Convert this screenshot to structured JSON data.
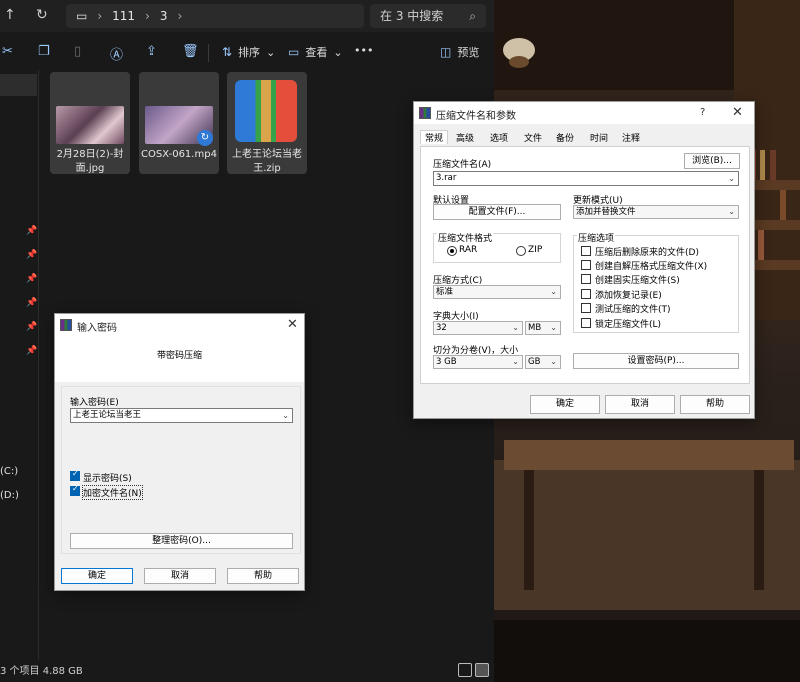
{
  "explorer": {
    "address": {
      "segments": [
        "111",
        "3"
      ],
      "search_placeholder": "在 3 中搜索"
    },
    "toolbar": {
      "sort_label": "排序",
      "view_label": "查看",
      "preview_label": "预览"
    },
    "files": [
      {
        "name": "2月28日(2)-封面.jpg",
        "icon": "image-thumbnail"
      },
      {
        "name": "COSX-061.mp4",
        "icon": "video-thumbnail"
      },
      {
        "name": "上老王论坛当老王.zip",
        "icon": "winrar-archive-icon"
      }
    ],
    "drives": [
      "(C:)",
      "(D:)"
    ],
    "status": "3 个项目   4.88 GB"
  },
  "archive_dialog": {
    "title": "压缩文件名和参数",
    "help_glyph": "?",
    "tabs": [
      "常规",
      "高级",
      "选项",
      "文件",
      "备份",
      "时间",
      "注释"
    ],
    "archive_name_label": "压缩文件名(A)",
    "browse_label": "浏览(B)...",
    "archive_name": "3.rar",
    "default_settings_label": "默认设置",
    "profiles_label": "配置文件(F)...",
    "update_mode_label": "更新模式(U)",
    "update_mode": "添加并替换文件",
    "format_label": "压缩文件格式",
    "format_rar": "RAR",
    "format_zip": "ZIP",
    "method_label": "压缩方式(C)",
    "method": "标准",
    "dict_label": "字典大小(I)",
    "dict_size": "32",
    "dict_unit": "MB",
    "split_label": "切分为分卷(V)，大小",
    "split_size": "3 GB",
    "split_unit": "GB",
    "options_label": "压缩选项",
    "options": [
      "压缩后删除原来的文件(D)",
      "创建自解压格式压缩文件(X)",
      "创建固实压缩文件(S)",
      "添加恢复记录(E)",
      "测试压缩的文件(T)",
      "锁定压缩文件(L)"
    ],
    "set_password_label": "设置密码(P)...",
    "ok_label": "确定",
    "cancel_label": "取消",
    "help_label": "帮助"
  },
  "password_dialog": {
    "title": "输入密码",
    "subtitle": "带密码压缩",
    "password_label": "输入密码(E)",
    "password_value": "上老王论坛当老王",
    "show_password_label": "显示密码(S)",
    "encrypt_names_label": "加密文件名(N)",
    "organize_label": "整理密码(O)...",
    "ok_label": "确定",
    "cancel_label": "取消",
    "help_label": "帮助"
  },
  "colors": {
    "explorer_bg": "#191919",
    "dialog_bg": "#f0f0f0",
    "accent": "#0063b1"
  }
}
